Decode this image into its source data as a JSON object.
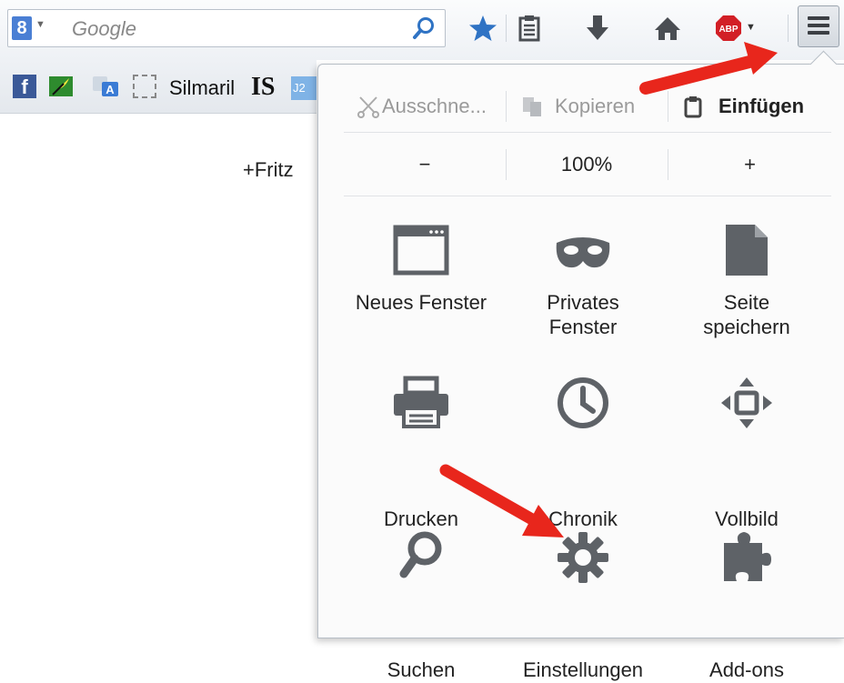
{
  "toolbar": {
    "search_engine_badge": "8",
    "search_placeholder": "Google",
    "buttons": [
      "bookmark-star",
      "reading-list",
      "downloads",
      "home",
      "adblock-plus",
      "open-menu"
    ],
    "abp_label": "ABP"
  },
  "bookmarks": {
    "silmaril_label": "Silmaril",
    "is_label": "IS",
    "j_label": "J2"
  },
  "page": {
    "link_text": "+Fritz"
  },
  "menu_panel": {
    "edit": {
      "cut_label": "Ausschne...",
      "copy_label": "Kopieren",
      "paste_label": "Einfügen"
    },
    "zoom": {
      "minus": "−",
      "level": "100%",
      "plus": "+"
    },
    "items": [
      {
        "id": "new-window",
        "line1": "Neues Fenster",
        "line2": ""
      },
      {
        "id": "private-window",
        "line1": "Privates",
        "line2": "Fenster"
      },
      {
        "id": "save-page",
        "line1": "Seite",
        "line2": "speichern"
      },
      {
        "id": "print",
        "line1": "Drucken",
        "line2": ""
      },
      {
        "id": "history",
        "line1": "Chronik",
        "line2": ""
      },
      {
        "id": "fullscreen",
        "line1": "Vollbild",
        "line2": ""
      },
      {
        "id": "search",
        "line1": "Suchen",
        "line2": ""
      },
      {
        "id": "preferences",
        "line1": "Einstellungen",
        "line2": ""
      },
      {
        "id": "addons",
        "line1": "Add-ons",
        "line2": ""
      }
    ]
  },
  "colors": {
    "icon_gray": "#5e6267",
    "accent_blue": "#2f73c4",
    "annotation_red": "#e8261c"
  }
}
